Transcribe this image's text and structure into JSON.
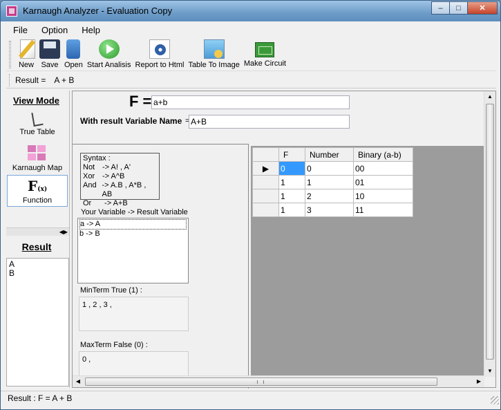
{
  "window": {
    "title": "Karnaugh Analyzer - Evaluation Copy",
    "controls": {
      "minimize": "–",
      "maximize": "□",
      "close": "✕"
    }
  },
  "menu": [
    "File",
    "Option",
    "Help"
  ],
  "toolbar": [
    {
      "label": "New",
      "icon": "new-file-icon"
    },
    {
      "label": "Save",
      "icon": "save-icon"
    },
    {
      "label": "Open",
      "icon": "open-icon"
    },
    {
      "label": "Start Analisis",
      "icon": "play-icon"
    },
    {
      "label": "Report to Html",
      "icon": "html-report-icon"
    },
    {
      "label": "Table To Image",
      "icon": "image-icon"
    },
    {
      "label": "Make Circuit",
      "icon": "circuit-icon"
    }
  ],
  "result_bar": {
    "label": "Result =",
    "value": "A + B"
  },
  "view_mode": {
    "title": "View Mode",
    "items": [
      {
        "label": "True Table",
        "icon": "truth-table-icon",
        "selected": false
      },
      {
        "label": "Karnaugh Map",
        "icon": "karnaugh-map-icon",
        "selected": false
      },
      {
        "label": "Function",
        "icon": "function-icon",
        "selected": true
      }
    ]
  },
  "result_panel": {
    "title": "Result",
    "lines": [
      "A",
      "B"
    ]
  },
  "function": {
    "f_label": "F =",
    "f_value": "a+b",
    "result_name_label": "With result Variable Name",
    "result_name_eq": "=",
    "result_name_value": "A+B"
  },
  "syntax": {
    "title": "Syntax :",
    "rows": [
      {
        "op": "Not",
        "examples": "-> A! , A'"
      },
      {
        "op": "Xor",
        "examples": "-> A^B"
      },
      {
        "op": "And",
        "examples": "-> A.B , A*B , AB"
      },
      {
        "op": "Or",
        "examples": " -> A+B"
      }
    ]
  },
  "variables": {
    "label": "Your Variable -> Result Variable",
    "items": [
      "a -> A",
      "b -> B"
    ]
  },
  "minterm": {
    "label": "MinTerm  True (1) :",
    "value": "1 , 2 , 3 ,"
  },
  "maxterm": {
    "label": "MaxTerm  False (0) :",
    "value": "0 ,"
  },
  "grid": {
    "columns": [
      "F",
      "Number",
      "Binary (a-b)"
    ],
    "rows": [
      {
        "indicator": "▶",
        "cells": [
          "0",
          "0",
          "00"
        ]
      },
      {
        "indicator": "",
        "cells": [
          "1",
          "1",
          "01"
        ]
      },
      {
        "indicator": "",
        "cells": [
          "1",
          "2",
          "10"
        ]
      },
      {
        "indicator": "",
        "cells": [
          "1",
          "3",
          "11"
        ]
      }
    ]
  },
  "status": {
    "text": "Result :  F = A + B"
  },
  "colors": {
    "selection": "#3399ff",
    "titlebar": "#6d9cc8"
  }
}
